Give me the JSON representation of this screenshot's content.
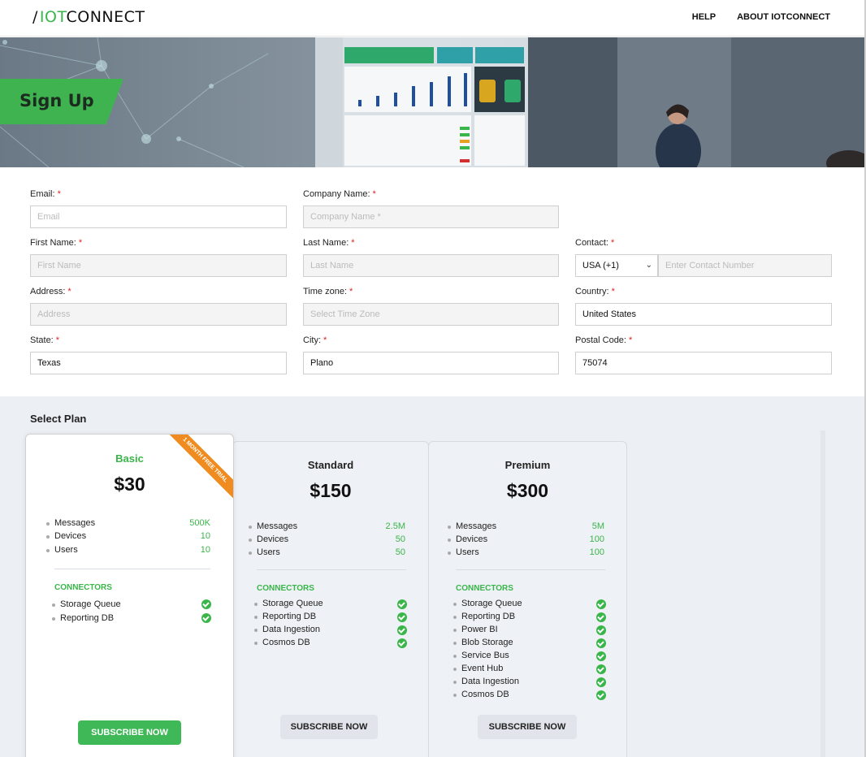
{
  "header": {
    "logo": {
      "slash": "/",
      "iot": "IOT",
      "connect": "CONNECT"
    },
    "nav": [
      "HELP",
      "ABOUT IOTCONNECT"
    ]
  },
  "hero": {
    "title": "Sign Up"
  },
  "form": {
    "email": {
      "label": "Email:",
      "placeholder": "Email",
      "value": ""
    },
    "company": {
      "label": "Company Name:",
      "placeholder": "Company Name *",
      "value": ""
    },
    "first_name": {
      "label": "First Name:",
      "placeholder": "First Name",
      "value": ""
    },
    "last_name": {
      "label": "Last Name:",
      "placeholder": "Last Name",
      "value": ""
    },
    "contact": {
      "label": "Contact:",
      "country_code": "USA (+1)",
      "placeholder": "Enter Contact Number",
      "value": ""
    },
    "address": {
      "label": "Address:",
      "placeholder": "Address",
      "value": ""
    },
    "timezone": {
      "label": "Time zone:",
      "placeholder": "Select Time Zone",
      "value": ""
    },
    "country": {
      "label": "Country:",
      "value": "United States"
    },
    "state": {
      "label": "State:",
      "value": "Texas"
    },
    "city": {
      "label": "City:",
      "value": "Plano"
    },
    "postal": {
      "label": "Postal Code:",
      "value": "75074"
    },
    "required_mark": "*"
  },
  "plans": {
    "title": "Select Plan",
    "ribbon": "1 MONTH FREE TRIAL",
    "connectors_title": "CONNECTORS",
    "subscribe_label": "SUBSCRIBE NOW",
    "metric_labels": [
      "Messages",
      "Devices",
      "Users"
    ],
    "items": [
      {
        "name": "Basic",
        "price": "$30",
        "metrics": [
          "500K",
          "10",
          "10"
        ],
        "connectors": [
          "Storage Queue",
          "Reporting DB"
        ]
      },
      {
        "name": "Standard",
        "price": "$150",
        "metrics": [
          "2.5M",
          "50",
          "50"
        ],
        "connectors": [
          "Storage Queue",
          "Reporting DB",
          "Data Ingestion",
          "Cosmos DB"
        ]
      },
      {
        "name": "Premium",
        "price": "$300",
        "metrics": [
          "5M",
          "100",
          "100"
        ],
        "connectors": [
          "Storage Queue",
          "Reporting DB",
          "Power BI",
          "Blob Storage",
          "Service Bus",
          "Event Hub",
          "Data Ingestion",
          "Cosmos DB"
        ]
      }
    ]
  },
  "colors": {
    "brand_green": "#3ab54a",
    "ribbon_orange": "#f08b1f",
    "required_red": "#dd2222"
  }
}
